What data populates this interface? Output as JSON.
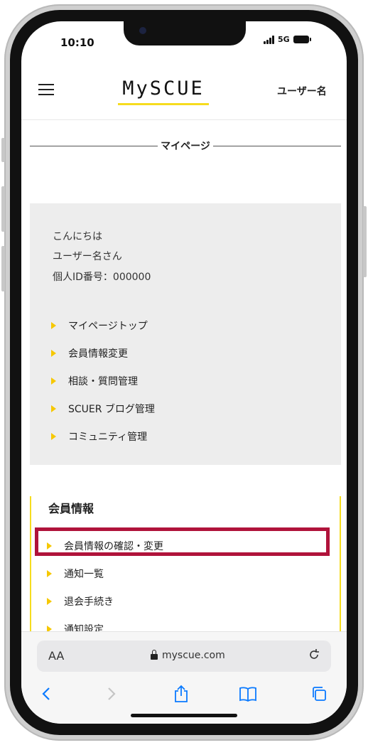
{
  "status_bar": {
    "time": "10:10",
    "network": "5G"
  },
  "header": {
    "logo_text": "MySCUE",
    "user_name": "ユーザー名"
  },
  "page_title": "マイページ",
  "greeting": {
    "line1": "こんにちは",
    "line2": "ユーザー名さん",
    "line3": "個人ID番号：000000"
  },
  "mypage_nav": [
    {
      "label": "マイページトップ"
    },
    {
      "label": "会員情報変更"
    },
    {
      "label": "相談・質問管理"
    },
    {
      "label": "SCUER ブログ管理"
    },
    {
      "label": "コミュニティ管理"
    }
  ],
  "member_section": {
    "title": "会員情報",
    "items": [
      {
        "label": "会員情報の確認・変更"
      },
      {
        "label": "通知一覧"
      },
      {
        "label": "退会手続き"
      },
      {
        "label": "通知設定"
      }
    ]
  },
  "browser": {
    "text_size_label": "AA",
    "url": "myscue.com",
    "icons": [
      "back-icon",
      "forward-icon",
      "share-icon",
      "bookmarks-icon",
      "tabs-icon",
      "reload-icon",
      "lock-icon"
    ]
  },
  "colors": {
    "accent_yellow": "#f6dc1e",
    "highlight_red": "#b0133b",
    "panel_gray": "#ededed",
    "ios_blue": "#0a7aff"
  }
}
